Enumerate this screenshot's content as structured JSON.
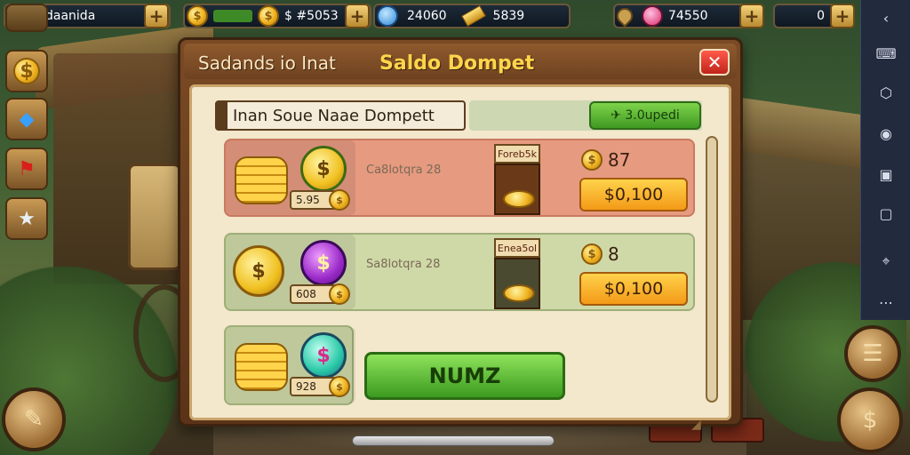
{
  "hud": {
    "app_name": "Indaanida",
    "gold_amount": "$ #5053",
    "gem_amount": "24060",
    "bars_amount": "5839",
    "shop_amount": "74550",
    "counter": "0"
  },
  "dialog": {
    "header_left": "Sadands io Inat",
    "title": "Saldo Dompet",
    "close": "✕",
    "subbar_label": "Inan Soue Naae Dompett",
    "green_small_label": "✈ 3.0upedi",
    "primary_button": "NUMZ"
  },
  "rows": [
    {
      "price": "5.95",
      "text": "Ca8lotqra 28",
      "gift_label": "Foreb5k",
      "amount": "87",
      "buy_label": "$0,100",
      "coin_symbol": "$"
    },
    {
      "price": "608",
      "text": "Sa8lotqra 28",
      "gift_label": "Enea5ol",
      "amount": "8",
      "buy_label": "$0,100",
      "coin_symbol": "$"
    },
    {
      "price": "928",
      "coin_symbol": "$"
    }
  ],
  "colors": {
    "dialog_frame": "#7a4a24",
    "title_yellow": "#ffd54a",
    "buy_orange": "#f39a18",
    "green_button": "#3c9a20",
    "row1_bg": "#e69a80",
    "row2_bg": "#cfd9a8"
  },
  "icons": {
    "left_sidebar": [
      "coin-medal-icon",
      "blue-crystal-icon",
      "red-banner-icon",
      "star-icon"
    ],
    "right_toolbar": [
      "back-arrow-icon",
      "keyboard-icon",
      "screenshot-icon",
      "settings-icon",
      "window-icon",
      "gallery-icon",
      "location-icon",
      "more-icon"
    ]
  }
}
